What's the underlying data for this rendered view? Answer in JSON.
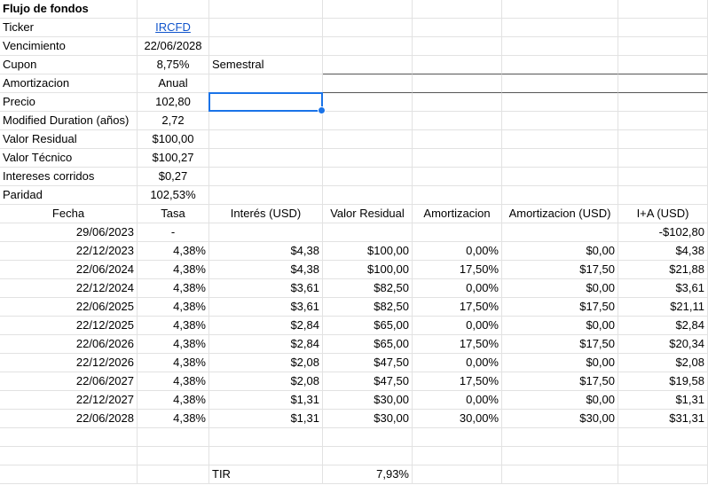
{
  "sheet": {
    "title": "Flujo de fondos",
    "info": [
      {
        "label": "Ticker",
        "value": "IRCFD",
        "link": true,
        "extra": ""
      },
      {
        "label": "Vencimiento",
        "value": "22/06/2028",
        "extra": ""
      },
      {
        "label": "Cupon",
        "value": "8,75%",
        "extra": "Semestral"
      },
      {
        "label": "Amortizacion",
        "value": "Anual",
        "extra": ""
      },
      {
        "label": "Precio",
        "value": "102,80",
        "extra": ""
      },
      {
        "label": "Modified Duration (años)",
        "value": "2,72",
        "extra": ""
      },
      {
        "label": "Valor Residual",
        "value": "$100,00",
        "extra": ""
      },
      {
        "label": "Valor Técnico",
        "value": "$100,27",
        "extra": ""
      },
      {
        "label": "Intereses corridos",
        "value": "$0,27",
        "extra": ""
      },
      {
        "label": "Paridad",
        "value": "102,53%",
        "extra": ""
      }
    ],
    "headers": [
      "Fecha",
      "Tasa",
      "Interés (USD)",
      "Valor Residual",
      "Amortizacion",
      "Amortizacion (USD)",
      "I+A (USD)"
    ],
    "rows": [
      [
        "29/06/2023",
        "-",
        "",
        "",
        "",
        "",
        "-$102,80"
      ],
      [
        "22/12/2023",
        "4,38%",
        "$4,38",
        "$100,00",
        "0,00%",
        "$0,00",
        "$4,38"
      ],
      [
        "22/06/2024",
        "4,38%",
        "$4,38",
        "$100,00",
        "17,50%",
        "$17,50",
        "$21,88"
      ],
      [
        "22/12/2024",
        "4,38%",
        "$3,61",
        "$82,50",
        "0,00%",
        "$0,00",
        "$3,61"
      ],
      [
        "22/06/2025",
        "4,38%",
        "$3,61",
        "$82,50",
        "17,50%",
        "$17,50",
        "$21,11"
      ],
      [
        "22/12/2025",
        "4,38%",
        "$2,84",
        "$65,00",
        "0,00%",
        "$0,00",
        "$2,84"
      ],
      [
        "22/06/2026",
        "4,38%",
        "$2,84",
        "$65,00",
        "17,50%",
        "$17,50",
        "$20,34"
      ],
      [
        "22/12/2026",
        "4,38%",
        "$2,08",
        "$47,50",
        "0,00%",
        "$0,00",
        "$2,08"
      ],
      [
        "22/06/2027",
        "4,38%",
        "$2,08",
        "$47,50",
        "17,50%",
        "$17,50",
        "$19,58"
      ],
      [
        "22/12/2027",
        "4,38%",
        "$1,31",
        "$30,00",
        "0,00%",
        "$0,00",
        "$1,31"
      ],
      [
        "22/06/2028",
        "4,38%",
        "$1,31",
        "$30,00",
        "30,00%",
        "$30,00",
        "$31,31"
      ]
    ],
    "tir": {
      "label": "TIR",
      "value": "7,93%"
    }
  },
  "colors": {
    "link": "#1155cc",
    "selection": "#1a73e8",
    "grid": "#e2e2e2"
  }
}
